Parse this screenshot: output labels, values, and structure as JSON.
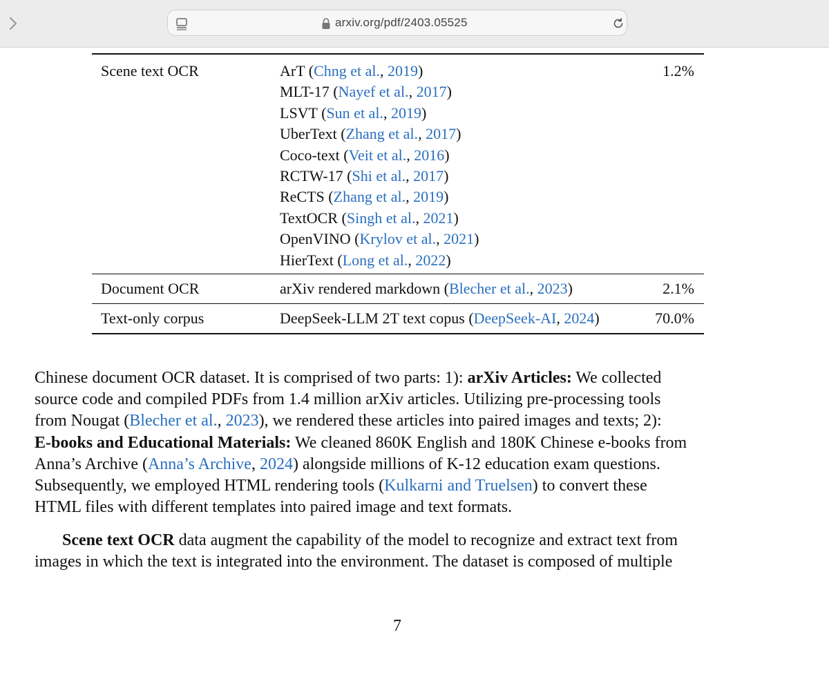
{
  "browser": {
    "url": "arxiv.org/pdf/2403.05525"
  },
  "table": {
    "scene": {
      "category": "Scene text OCR",
      "items": [
        {
          "name": "ArT",
          "authors": "Chng et al.",
          "year": "2019"
        },
        {
          "name": "MLT-17",
          "authors": "Nayef et al.",
          "year": "2017"
        },
        {
          "name": "LSVT",
          "authors": "Sun et al.",
          "year": "2019"
        },
        {
          "name": "UberText",
          "authors": "Zhang et al.",
          "year": "2017"
        },
        {
          "name": "Coco-text",
          "authors": "Veit et al.",
          "year": "2016"
        },
        {
          "name": "RCTW-17",
          "authors": "Shi et al.",
          "year": "2017"
        },
        {
          "name": "ReCTS",
          "authors": "Zhang et al.",
          "year": "2019"
        },
        {
          "name": "TextOCR",
          "authors": "Singh et al.",
          "year": "2021"
        },
        {
          "name": "OpenVINO",
          "authors": "Krylov et al.",
          "year": "2021"
        },
        {
          "name": "HierText",
          "authors": "Long et al.",
          "year": "2022"
        }
      ],
      "ratio": "1.2%"
    },
    "document": {
      "category": "Document OCR",
      "name": "arXiv rendered markdown",
      "authors": "Blecher et al.",
      "year": "2023",
      "ratio": "2.1%"
    },
    "textonly": {
      "category": "Text-only corpus",
      "name": "DeepSeek-LLM 2T text copus",
      "authors": "DeepSeek-AI",
      "year": "2024",
      "ratio": "70.0%"
    }
  },
  "para1": {
    "l1_a": "Chinese document OCR dataset. It is comprised of two parts: 1): ",
    "l1_b": "arXiv Articles:",
    "l1_c": " We collected",
    "l2": "source code and compiled PDFs from 1.4 million arXiv articles. Utilizing pre-processing tools",
    "l3_a": "from Nougat (",
    "l3_cite": "Blecher et al.",
    "l3_sep": ", ",
    "l3_year": "2023",
    "l3_b": "), we rendered these articles into paired images and texts; 2):",
    "l4_a": "E-books and Educational Materials:",
    "l4_b": " We cleaned 860K English and 180K Chinese e-books from",
    "l5_a": "Anna’s Archive (",
    "l5_cite": "Anna’s Archive",
    "l5_sep": ", ",
    "l5_year": "2024",
    "l5_b": ") alongside millions of K-12 education exam questions.",
    "l6_a": "Subsequently, we employed HTML rendering tools (",
    "l6_cite": "Kulkarni and Truelsen",
    "l6_b": ") to convert these",
    "l7": "HTML files with different templates into paired image and text formats."
  },
  "para2": {
    "l1_a": "Scene text OCR",
    "l1_b": " data augment the capability of the model to recognize and extract text from",
    "l2": "images in which the text is integrated into the environment. The dataset is composed of multiple"
  },
  "page_number": "7"
}
